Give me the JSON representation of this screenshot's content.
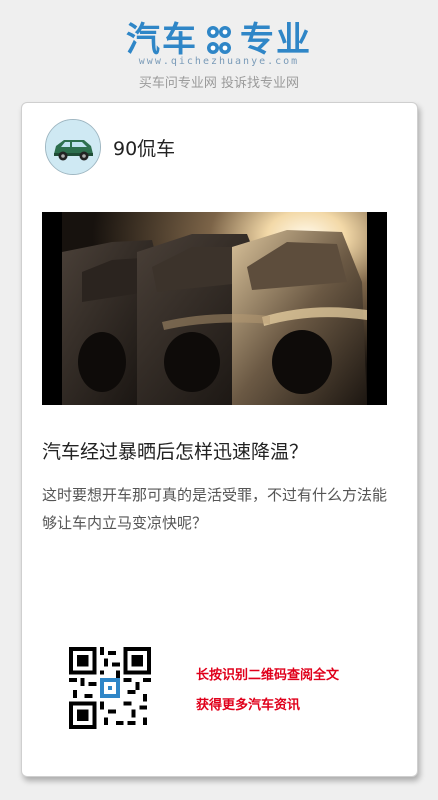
{
  "header": {
    "logo_left": "汽车",
    "logo_right": "专业",
    "domain": "www.qichezhuanye.com",
    "slogan": "买车问专业网 投诉找专业网"
  },
  "post": {
    "author": "90侃车",
    "title": "汽车经过暴晒后怎样迅速降温？",
    "description": "这时要想开车那可真的是活受罪，不过有什么方法能够让车内立马变凉快呢？"
  },
  "footer": {
    "cta_line1": "长按识别二维码查阅全文",
    "cta_line2": "获得更多汽车资讯"
  },
  "colors": {
    "brand_blue": "#2f86c7",
    "cta_red": "#e0001b"
  }
}
